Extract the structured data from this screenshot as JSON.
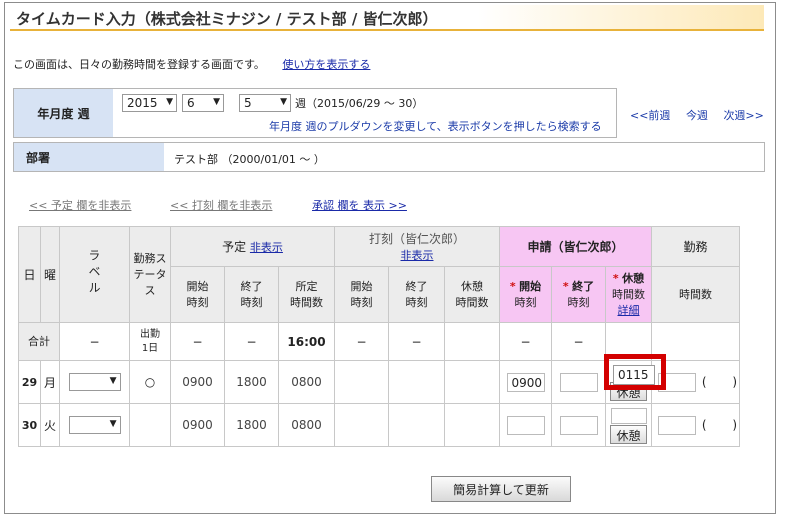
{
  "title": "タイムカード入力（株式会社ミナジン / テスト部 / 皆仁次郎）",
  "intro": {
    "text": "この画面は、日々の勤務時間を登録する画面です。",
    "help_link": "使い方を表示する"
  },
  "period": {
    "label": "年月度 週",
    "year": "2015",
    "month": "6",
    "week": "5",
    "week_suffix": "週（2015/06/29 〜 30）",
    "hint": "年月度 週のプルダウンを変更して、表示ボタンを押したら検索する",
    "nav": [
      "<<前週",
      "今週",
      "次週>>"
    ]
  },
  "department": {
    "label": "部署",
    "value": "テスト部 （2000/01/01 〜 ）"
  },
  "toggles": {
    "plan": "<< 予定 欄を非表示",
    "stamp": "<< 打刻 欄を非表示",
    "approval": "承認 欄を 表示 >>"
  },
  "headers": {
    "day": "日",
    "weekday": "曜",
    "label": "ラベル",
    "status": "勤務ステータス",
    "plan_group": "予定",
    "plan_hide": "非表示",
    "stamp_group": "打刻（皆仁次郎）",
    "stamp_hide": "非表示",
    "req_group": "申請（皆仁次郎）",
    "work_group": "勤務",
    "start": "開始",
    "end": "終了",
    "time": "時刻",
    "sched_hours_top": "所定",
    "hours": "時間数",
    "break": "休憩",
    "detail": "詳細",
    "req_mark": "*"
  },
  "totals": {
    "label": "合計",
    "dash": "−",
    "status_top": "出勤",
    "status_bottom": "1日",
    "sched_hours": "16:00"
  },
  "rows": [
    {
      "day": "29",
      "weekday": "月",
      "status": "○",
      "plan_start": "0900",
      "plan_end": "1800",
      "plan_hours": "0800",
      "req_start": "0900",
      "req_break": "0115",
      "break_btn": "休憩",
      "paren_open": "(",
      "paren_close": ")"
    },
    {
      "day": "30",
      "weekday": "火",
      "status": "",
      "plan_start": "0900",
      "plan_end": "1800",
      "plan_hours": "0800",
      "req_start": "",
      "req_break": "",
      "break_btn": "休憩",
      "paren_open": "(",
      "paren_close": ")"
    }
  ],
  "update_button": "簡易計算して更新",
  "colors": {
    "accent_orange": "#e8b23a",
    "header_blue": "#d7e3f4",
    "request_pink": "#f7c6f3",
    "highlight_red": "#d30000",
    "link_blue": "#1a2aa8"
  }
}
